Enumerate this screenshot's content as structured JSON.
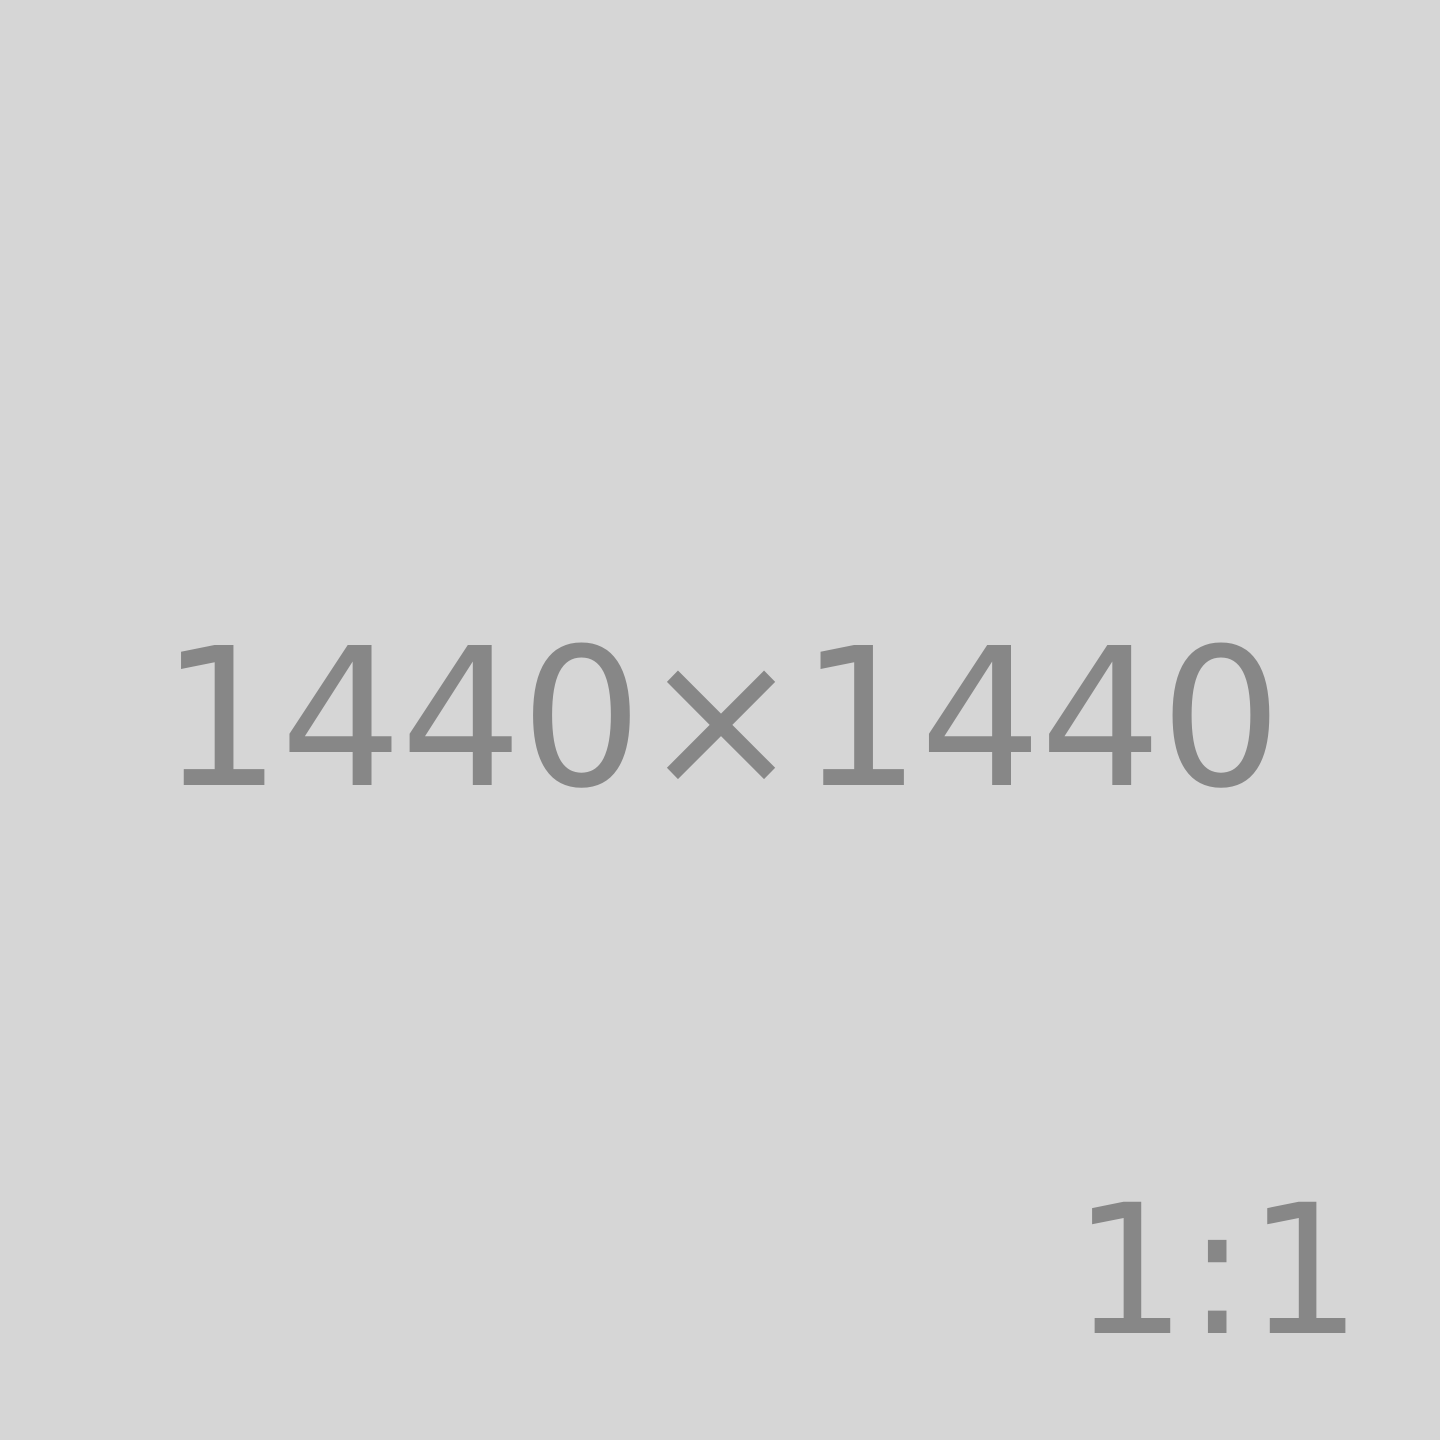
{
  "placeholder": {
    "dimensions_text": "1440×1440",
    "ratio_text": "1:1",
    "colors": {
      "background": "#d6d6d6",
      "text": "#878787"
    }
  }
}
